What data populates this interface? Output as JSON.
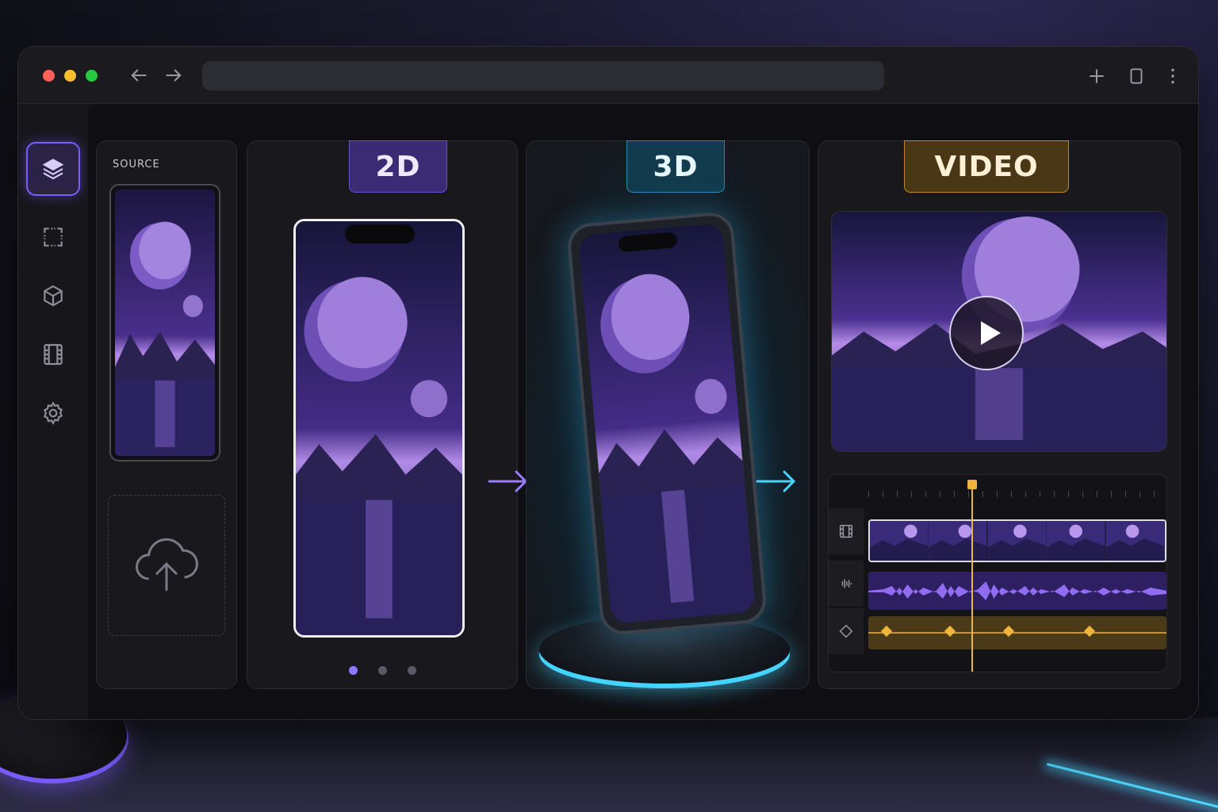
{
  "window": {
    "traffic_lights": [
      "close",
      "minimize",
      "maximize"
    ],
    "nav": {
      "back_icon": "arrow-left-icon",
      "forward_icon": "arrow-right-icon"
    },
    "address_value": "",
    "toolbar_icons": [
      "plus-icon",
      "square-icon",
      "more-vertical-icon"
    ]
  },
  "sidebar": {
    "items": [
      {
        "icon": "layers-icon",
        "active": true
      },
      {
        "icon": "frame-select-icon",
        "active": false
      },
      {
        "icon": "cube-icon",
        "active": false
      },
      {
        "icon": "film-icon",
        "active": false
      },
      {
        "icon": "gear-icon",
        "active": false
      }
    ]
  },
  "source": {
    "label": "SOURCE",
    "upload_icon": "cloud-upload-icon"
  },
  "stages": {
    "two_d": {
      "label": "2D",
      "pages": 3,
      "active_page": 1
    },
    "three_d": {
      "label": "3D"
    },
    "video": {
      "label": "VIDEO"
    }
  },
  "timeline": {
    "tracks": [
      "film-strip-icon",
      "audio-wave-icon",
      "keyframe-diamond-icon"
    ],
    "film_frames": 5,
    "keyframes": [
      0.06,
      0.27,
      0.47,
      0.74
    ],
    "playhead_position": 0.34
  },
  "colors": {
    "accent_purple": "#7c5cff",
    "accent_cyan": "#45d4ff",
    "accent_gold": "#f1b43c"
  }
}
